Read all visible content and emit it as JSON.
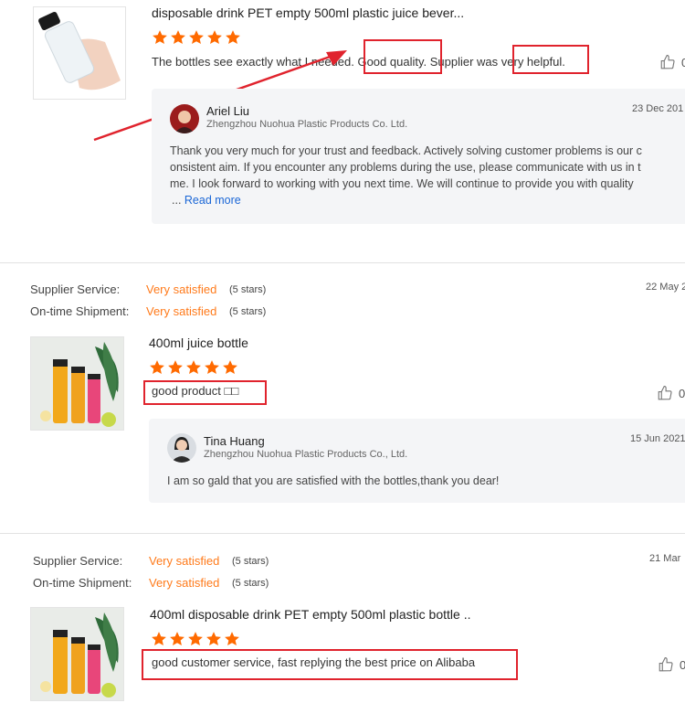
{
  "colors": {
    "star": "#ff6a00",
    "accent_orange": "#ff7a1a",
    "highlight_red": "#e0232d",
    "link_blue": "#1a66d6",
    "reply_bg": "#f4f5f7"
  },
  "reviews": [
    {
      "product_title": "disposable drink PET empty 500ml plastic juice bever...",
      "rating": 5,
      "comment_parts": [
        "The bottles see exactly what I needed. ",
        "Good quality",
        ". Supplier was ",
        "very helpful",
        "."
      ],
      "likes": "0",
      "reply": {
        "name": "Ariel Liu",
        "company": "Zhengzhou Nuohua Plastic Products Co. Ltd.",
        "date": "23 Dec 201",
        "lines": [
          "Thank you very much for your trust and feedback. Actively solving customer problems is our c",
          "onsistent aim. If you encounter any problems during the use, please communicate with us in t",
          "me. I look forward to working with you next time. We will continue to provide you with quality"
        ],
        "ellipsis": "...",
        "read_more": "Read more"
      }
    },
    {
      "supplier_service_label": "Supplier Service:",
      "supplier_service_value": "Very satisfied",
      "supplier_service_stars": "(5 stars)",
      "ontime_label": "On-time Shipment:",
      "ontime_value": "Very satisfied",
      "ontime_stars": "(5 stars)",
      "date": "22 May 2",
      "product_title": "400ml juice bottle",
      "rating": 5,
      "comment": "good product □□",
      "likes": "0",
      "reply": {
        "name": "Tina Huang",
        "company": "Zhengzhou Nuohua Plastic Products Co., Ltd.",
        "date": "15 Jun 2021",
        "text": "I am so gald that you are satisfied with the bottles,thank you dear!"
      }
    },
    {
      "supplier_service_label": "Supplier Service:",
      "supplier_service_value": "Very satisfied",
      "supplier_service_stars": "(5 stars)",
      "ontime_label": "On-time Shipment:",
      "ontime_value": "Very satisfied",
      "ontime_stars": "(5 stars)",
      "date": "21 Mar",
      "product_title": "400ml disposable drink PET empty 500ml plastic bottle ..",
      "rating": 5,
      "comment": "good customer service, fast replying the best price on Alibaba",
      "likes": "0"
    }
  ]
}
